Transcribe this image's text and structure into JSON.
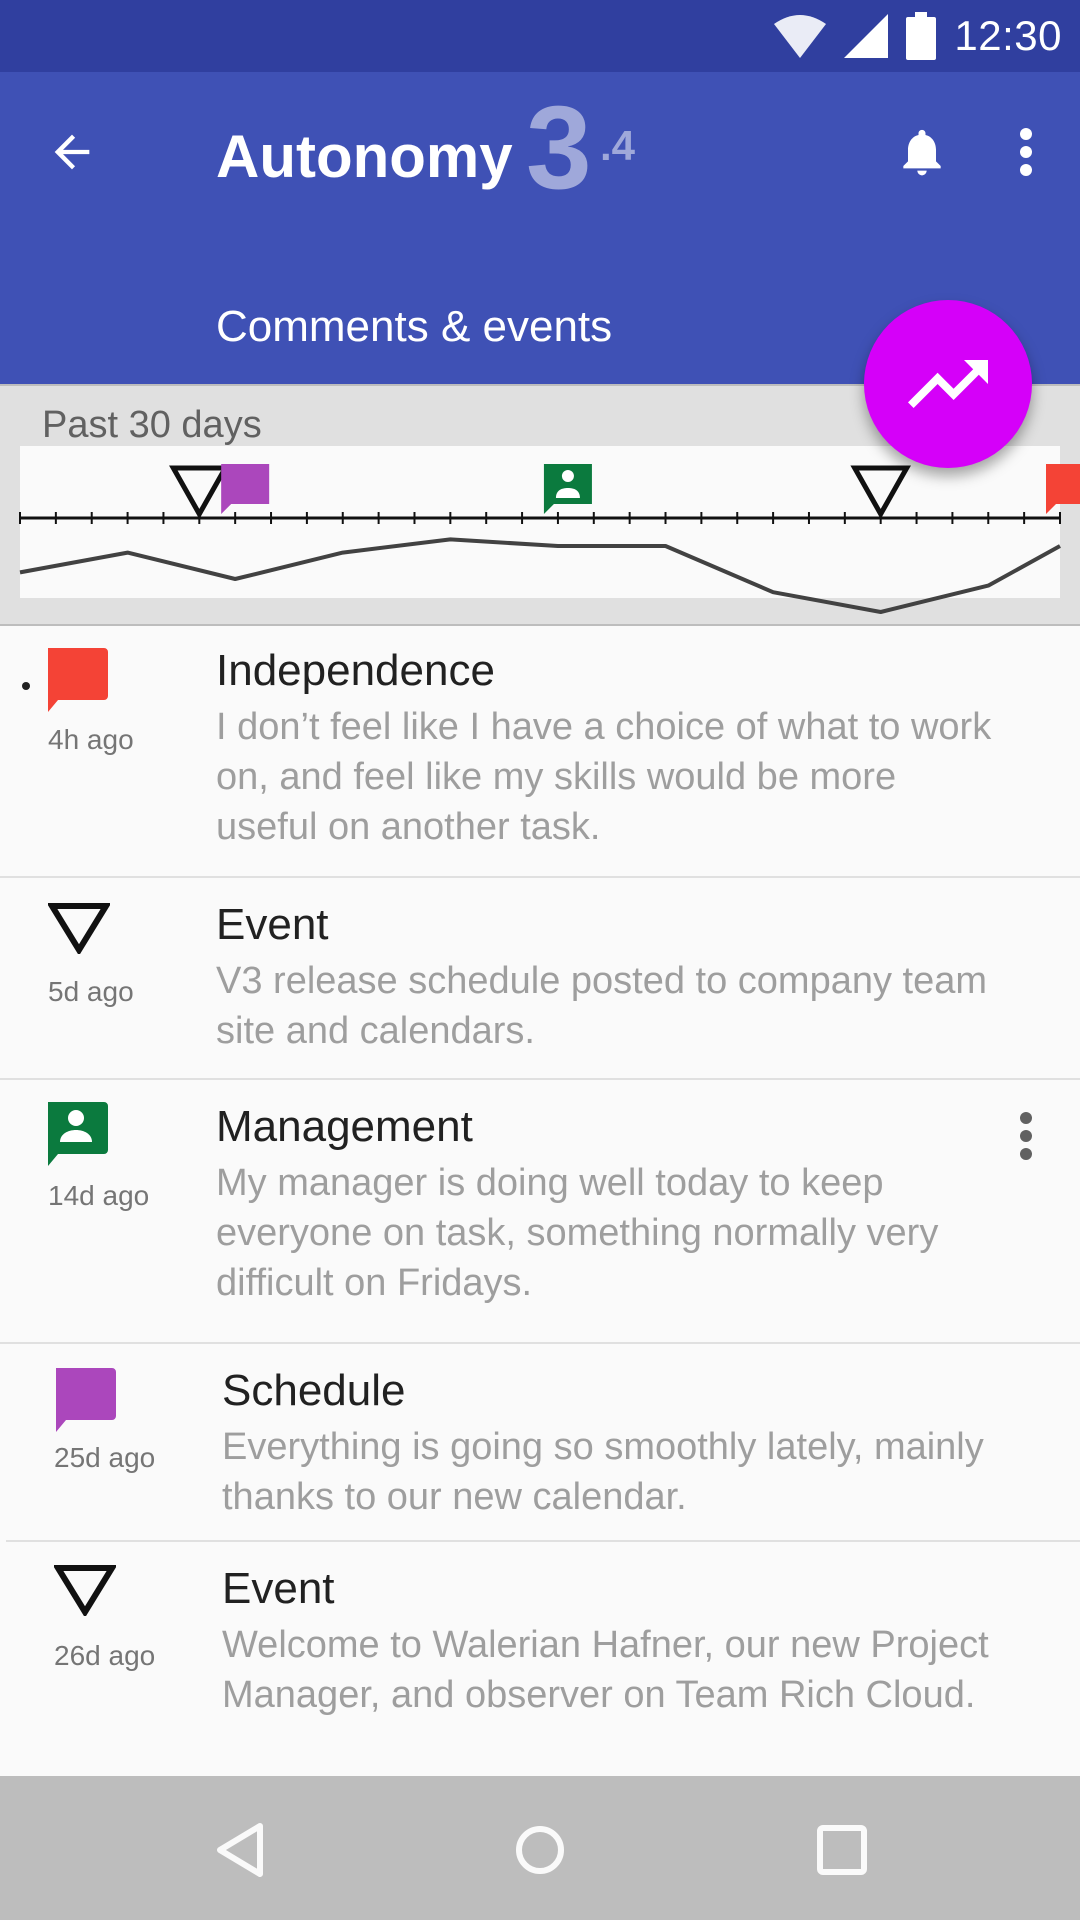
{
  "status_bar": {
    "time": "12:30"
  },
  "app_bar": {
    "title": "Autonomy",
    "score_main": "3",
    "score_decimal": ".4",
    "subtitle": "Comments & events"
  },
  "chart": {
    "label": "Past 30 days"
  },
  "chart_data": {
    "type": "line",
    "x": [
      0,
      3,
      6,
      9,
      12,
      15,
      18,
      21,
      24,
      27,
      29
    ],
    "values": [
      3.2,
      3.5,
      3.1,
      3.5,
      3.7,
      3.6,
      3.6,
      2.9,
      2.6,
      3.0,
      3.6
    ],
    "events": [
      {
        "day": 5,
        "type": "event"
      },
      {
        "day": 6,
        "type": "comment-purple"
      },
      {
        "day": 15,
        "type": "comment-green"
      },
      {
        "day": 24,
        "type": "event"
      },
      {
        "day": 29,
        "type": "comment-red"
      }
    ]
  },
  "colors": {
    "status_bar": "#303f9f",
    "primary": "#3f51b5",
    "fab": "#d500f9",
    "red_comment": "#f44336",
    "green_comment": "#0b7a3e",
    "purple_comment": "#ab47bc"
  },
  "items": [
    {
      "icon": "red-comment-icon",
      "title": "Independence",
      "age": "4h ago",
      "body": "I don’t feel like I have a choice of what to work on, and feel like my skills would be more useful on another task."
    },
    {
      "icon": "event-triangle-icon",
      "title": "Event",
      "age": "5d ago",
      "body": "V3 release schedule posted to company team site and calendars."
    },
    {
      "icon": "green-person-comment-icon",
      "title": "Management",
      "age": "14d ago",
      "body": "My manager is doing well today to keep everyone on task, something normally very difficult on Fridays."
    },
    {
      "icon": "purple-comment-icon",
      "title": "Schedule",
      "age": "25d ago",
      "body": "Everything is going so smoothly lately, mainly thanks to our new calendar."
    },
    {
      "icon": "event-triangle-icon",
      "title": "Event",
      "age": "26d ago",
      "body": "Welcome to Walerian Hafner, our new Project Manager, and observer on Team Rich Cloud."
    }
  ]
}
